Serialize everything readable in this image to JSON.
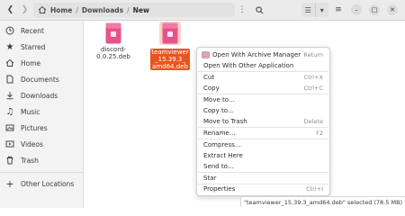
{
  "headerbar": {
    "path": [
      "Home",
      "Downloads",
      "New"
    ],
    "icons": [
      "chevron-left-icon",
      "chevron-right-icon",
      "home-icon",
      "more-vert-icon",
      "search-icon",
      "list-view-icon",
      "chevron-down-icon",
      "hamburger-icon",
      "minimize-icon",
      "maximize-icon",
      "close-icon"
    ]
  },
  "sidebar": {
    "items": [
      {
        "label": "Recent",
        "icon": "clock-icon"
      },
      {
        "label": "Starred",
        "icon": "star-icon"
      },
      {
        "label": "Home",
        "icon": "home-icon"
      },
      {
        "label": "Documents",
        "icon": "document-icon"
      },
      {
        "label": "Downloads",
        "icon": "download-icon"
      },
      {
        "label": "Music",
        "icon": "music-icon"
      },
      {
        "label": "Pictures",
        "icon": "picture-icon"
      },
      {
        "label": "Videos",
        "icon": "video-icon"
      },
      {
        "label": "Trash",
        "icon": "trash-icon"
      },
      {
        "label": "Other Locations",
        "icon": "plus-icon"
      }
    ]
  },
  "files": [
    {
      "name": "discord-\n0.0.25.deb",
      "selected": false
    },
    {
      "name": "teamviewer\n_15.39.3_\namd64.deb",
      "selected": true
    }
  ],
  "context_menu": {
    "items": [
      {
        "label": "Open With Archive Manager",
        "accel": "Return",
        "icon": "archive-icon"
      },
      {
        "label": "Open With Other Application",
        "accel": ""
      },
      {
        "label": "Cut",
        "accel": "Ctrl+X"
      },
      {
        "label": "Copy",
        "accel": "Ctrl+C"
      },
      {
        "label": "Move to…",
        "accel": ""
      },
      {
        "label": "Copy to…",
        "accel": ""
      },
      {
        "label": "Move to Trash",
        "accel": "Delete"
      },
      {
        "label": "Rename…",
        "accel": "F2"
      },
      {
        "label": "Compress…",
        "accel": ""
      },
      {
        "label": "Extract Here",
        "accel": ""
      },
      {
        "label": "Send to…",
        "accel": ""
      },
      {
        "label": "Star",
        "accel": ""
      },
      {
        "label": "Properties",
        "accel": "Ctrl+I"
      }
    ]
  },
  "status": "\"teamviewer_15.39.3_amd64.deb\" selected  (78.5 MB)",
  "colors": {
    "accent": "#e95420",
    "package": "#e8528a"
  }
}
